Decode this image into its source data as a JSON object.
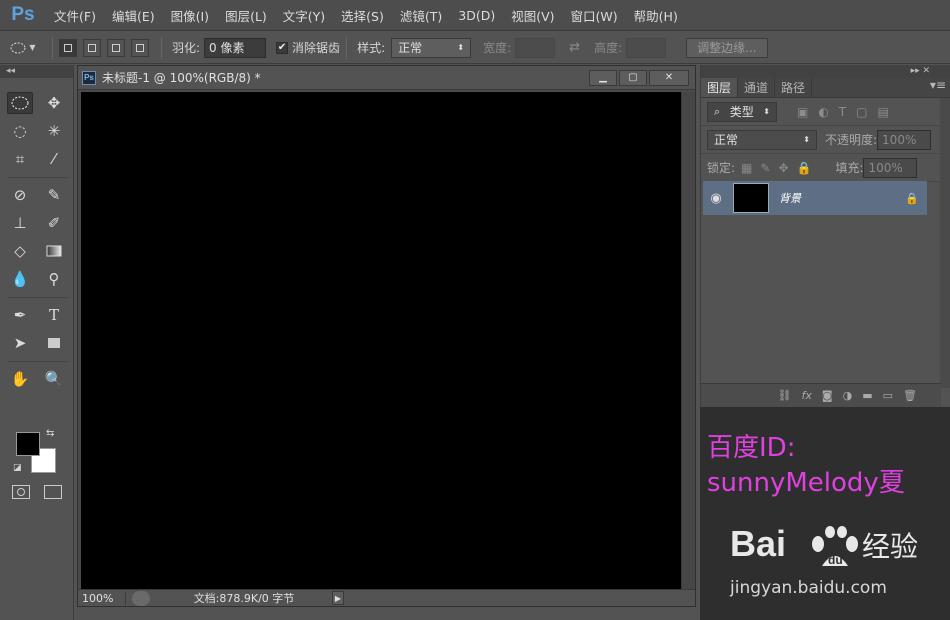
{
  "app": {
    "logo": "Ps"
  },
  "menu": [
    "文件(F)",
    "编辑(E)",
    "图像(I)",
    "图层(L)",
    "文字(Y)",
    "选择(S)",
    "滤镜(T)",
    "3D(D)",
    "视图(V)",
    "窗口(W)",
    "帮助(H)"
  ],
  "options": {
    "feather_label": "羽化:",
    "feather_value": "0 像素",
    "antialias_label": "消除锯齿",
    "antialias_checked": true,
    "style_label": "样式:",
    "style_value": "正常",
    "width_label": "宽度:",
    "height_label": "高度:",
    "refine_button": "调整边缘..."
  },
  "document": {
    "title": "未标题-1 @ 100%(RGB/8) *",
    "canvas_color": "#000000",
    "zoom": "100%",
    "doc_info": "文档:878.9K/0 字节"
  },
  "colors": {
    "foreground": "#000000",
    "background": "#ffffff",
    "accent": "#5fa2dd"
  },
  "layers_panel": {
    "tabs": [
      "图层",
      "通道",
      "路径"
    ],
    "filter_label": "类型",
    "blend_mode": "正常",
    "opacity_label": "不透明度:",
    "opacity_value": "100%",
    "lock_label": "锁定:",
    "fill_label": "填充:",
    "fill_value": "100%",
    "layers": [
      {
        "name": "背景",
        "visible": true,
        "locked": true
      }
    ]
  },
  "watermark": {
    "line1": "百度ID:",
    "line2": "sunnyMelody夏",
    "baidu_logo": "Bai du 经验",
    "baidu_url": "jingyan.baidu.com"
  }
}
